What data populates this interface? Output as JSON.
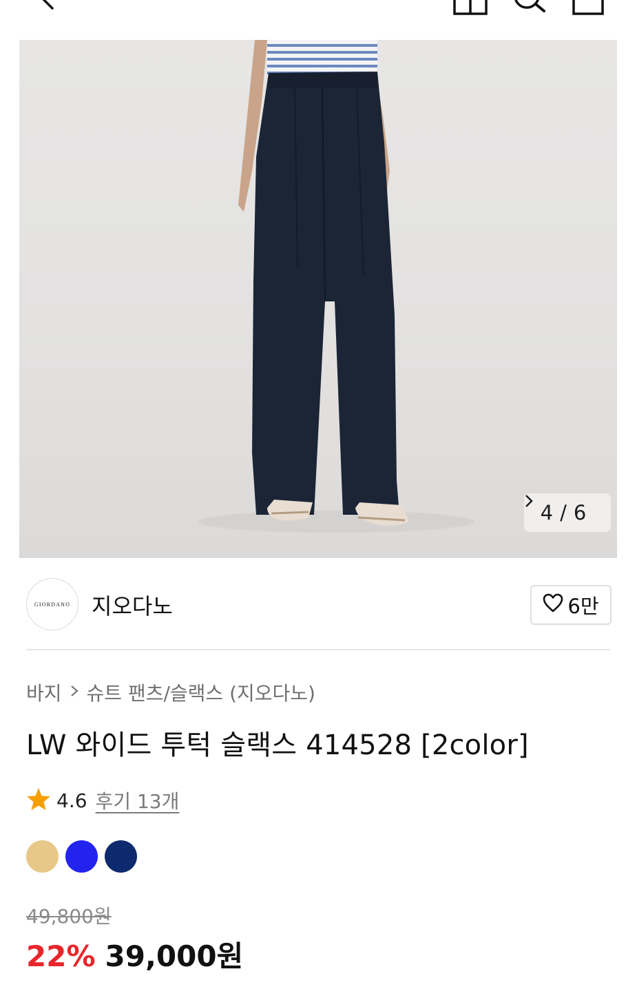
{
  "header": {
    "icons": [
      "back-icon",
      "store-icon",
      "search-icon",
      "cart-icon"
    ]
  },
  "gallery": {
    "current": "4",
    "separator": "/",
    "total": "6"
  },
  "brand": {
    "logo_text": "GIORDANO",
    "name": "지오다노",
    "likes": "6만"
  },
  "breadcrumb": {
    "category": "바지",
    "subcategory": "슈트 팬츠/슬랙스 (지오다노)"
  },
  "product": {
    "title": "LW 와이드 투턱 슬랙스 414528 [2color]",
    "rating": "4.6",
    "review_label": "후기 13개",
    "swatches": [
      "#e8c888",
      "#2323f0",
      "#0e2a6e"
    ],
    "original_price": "49,800원",
    "discount": "22%",
    "sale_price": "39,000원"
  },
  "colors": {
    "discount": "#e8262b",
    "star": "#f5a000",
    "pants": "#1b2536"
  }
}
